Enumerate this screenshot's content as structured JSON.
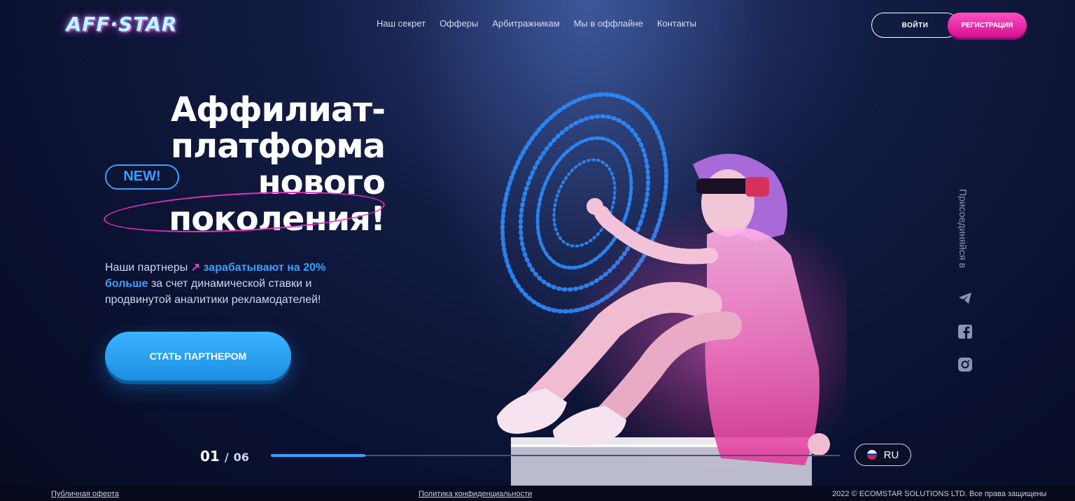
{
  "header": {
    "logo_text": "AFF·STAR",
    "nav": [
      "Наш секрет",
      "Офферы",
      "Арбитражникам",
      "Мы в оффлайне",
      "Контакты"
    ],
    "login_label": "ВОЙТИ",
    "register_label": "РЕГИСТРАЦИЯ"
  },
  "hero": {
    "title_lines": [
      "Аффилиат-",
      "платформа",
      "нового",
      "поколения!"
    ],
    "badge": "NEW!",
    "subtitle": {
      "part1": "Наши партнеры ",
      "arrow": "↗",
      "highlight": "зарабатывают на 20% больше",
      "part2": " за счет динамической ставки и продвинутой аналитики рекламодателей!"
    },
    "cta_label": "СТАТЬ ПАРТНЕРОМ"
  },
  "social": {
    "title": "Присоединяйся в",
    "icons": [
      "telegram-icon",
      "facebook-icon",
      "instagram-icon"
    ]
  },
  "slider": {
    "current": "01",
    "separator": "/",
    "total": "06",
    "progress": 0.166
  },
  "language": {
    "label": "RU",
    "flag_colors": [
      "#ffffff",
      "#1c4fbf",
      "#d8262c"
    ]
  },
  "footer": {
    "offer_link": "Публичная оферта",
    "privacy_link": "Политика конфиденциальности",
    "copyright": "2022 © ECOMSTAR SOLUTIONS LTD. Все права защищены"
  },
  "colors": {
    "accent_blue": "#3aa0ff",
    "accent_pink": "#e52fba",
    "background": "#0a1130"
  }
}
